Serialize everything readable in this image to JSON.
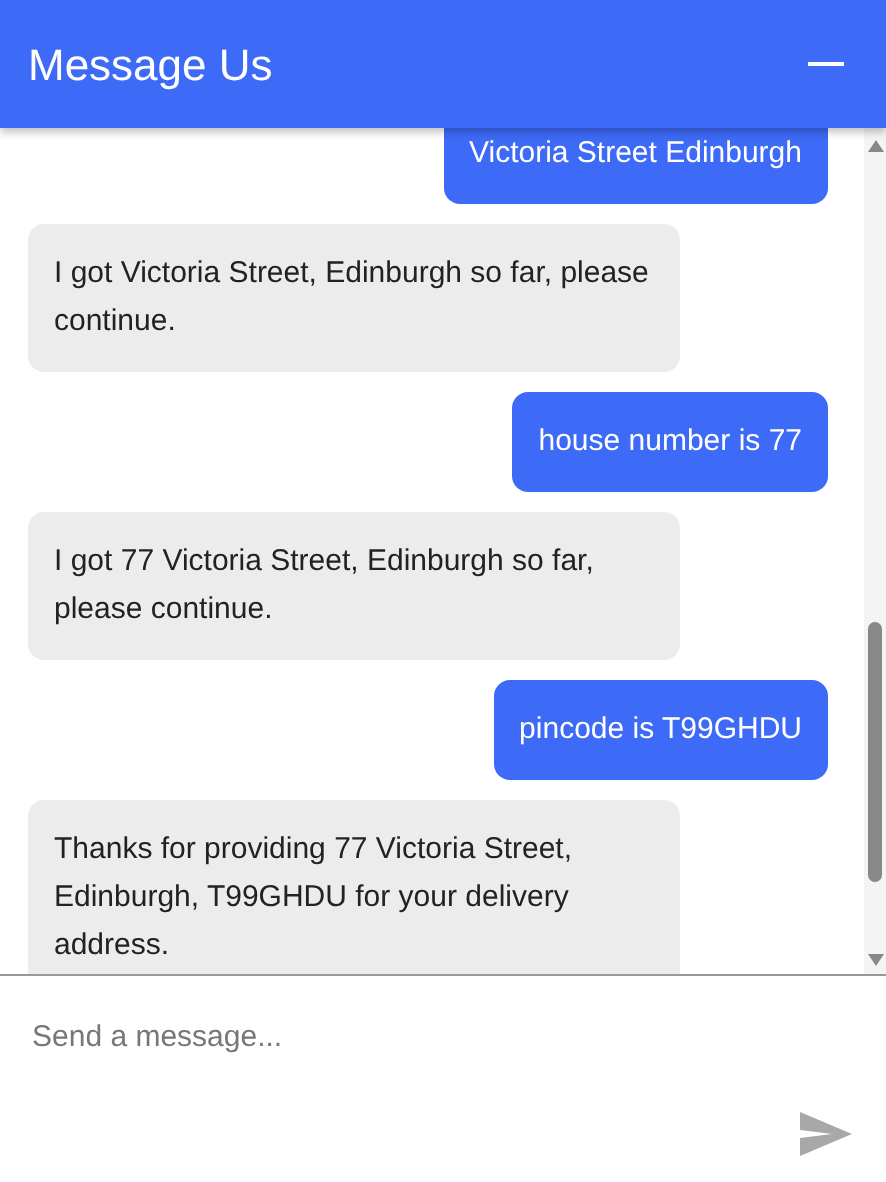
{
  "header": {
    "title": "Message Us"
  },
  "messages": [
    {
      "kind": "user",
      "text": "Victoria Street Edinburgh"
    },
    {
      "kind": "bot",
      "text": "I got Victoria Street, Edinburgh so far, please continue."
    },
    {
      "kind": "user",
      "text": "house number is 77"
    },
    {
      "kind": "bot",
      "text": "I got 77 Victoria Street, Edinburgh so far, please continue."
    },
    {
      "kind": "user",
      "text": "pincode is T99GHDU"
    },
    {
      "kind": "bot",
      "text": "Thanks for providing 77 Victoria Street, Edinburgh, T99GHDU for your delivery address."
    }
  ],
  "composer": {
    "placeholder": "Send a message..."
  }
}
